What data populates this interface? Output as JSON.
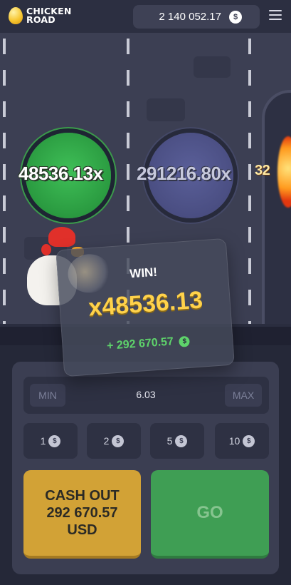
{
  "header": {
    "logo_line1": "CHICKEN",
    "logo_line2": "ROAD",
    "balance": "2 140 052.17",
    "currency_symbol": "$"
  },
  "road": {
    "lanes": [
      {
        "multiplier": "48536.13x",
        "state": "passed"
      },
      {
        "multiplier": "291216.80x",
        "state": "next"
      },
      {
        "multiplier": "32"
      }
    ]
  },
  "win_popup": {
    "title": "WIN!",
    "multiplier": "x48536.13",
    "amount": "+ 292 670.57",
    "currency_symbol": "$"
  },
  "bet": {
    "min_label": "MIN",
    "max_label": "MAX",
    "value": "6.03",
    "quick_amounts": [
      {
        "value": "1",
        "currency_symbol": "$"
      },
      {
        "value": "2",
        "currency_symbol": "$"
      },
      {
        "value": "5",
        "currency_symbol": "$"
      },
      {
        "value": "10",
        "currency_symbol": "$"
      }
    ]
  },
  "actions": {
    "cashout_line1": "CASH OUT",
    "cashout_amount": "292 670.57",
    "cashout_currency": "USD",
    "go_label": "GO"
  },
  "colors": {
    "win_multiplier": "#ffd24a",
    "win_amount": "#5ed36b",
    "cashout_bg": "#d2a236",
    "go_bg": "#3f9e54",
    "passed_lane_coin": "#2a9a40",
    "next_lane_coin": "#4a4e82"
  },
  "icons": {
    "logo": "golden-egg-icon",
    "menu": "hamburger-menu-icon",
    "currency": "dollar-coin-icon"
  }
}
